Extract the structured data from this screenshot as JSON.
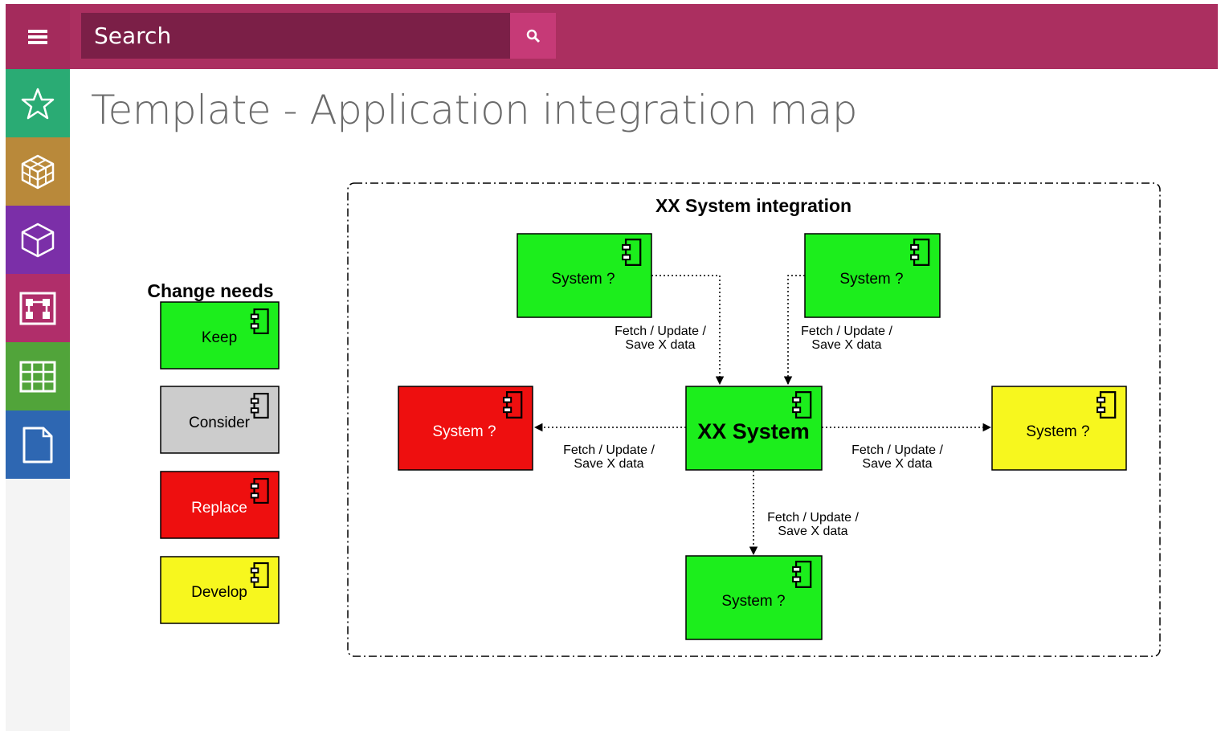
{
  "colors": {
    "topbar": "#ab2f60",
    "search_bg": "#7b1f47",
    "search_button": "#c63a77",
    "keep": "#1cee1c",
    "consider": "#cccccc",
    "replace": "#ee0f0f",
    "develop": "#f7f71e"
  },
  "header": {
    "menu_icon": "hamburger-menu-icon",
    "search_placeholder": "Search",
    "search_icon": "magnifier-icon"
  },
  "sidebar": {
    "items": [
      {
        "icon": "star-icon",
        "color": "#2aab74"
      },
      {
        "icon": "cubes-icon",
        "color": "#b9893a"
      },
      {
        "icon": "cube-icon",
        "color": "#7b2fa8"
      },
      {
        "icon": "integration-board-icon",
        "color": "#b02e6a"
      },
      {
        "icon": "table-grid-icon",
        "color": "#51a43a"
      },
      {
        "icon": "document-icon",
        "color": "#2e67b2"
      }
    ]
  },
  "page": {
    "title": "Template - Application integration map"
  },
  "legend": {
    "title": "Change needs",
    "items": [
      {
        "label": "Keep"
      },
      {
        "label": "Consider"
      },
      {
        "label": "Replace"
      },
      {
        "label": "Develop"
      }
    ]
  },
  "diagram": {
    "title": "XX System integration",
    "center_label": "XX System",
    "nodes": [
      {
        "label": "System ?"
      },
      {
        "label": "System ?"
      },
      {
        "label": "System ?"
      },
      {
        "label": "System ?"
      },
      {
        "label": "System ?"
      }
    ],
    "edge_label_line1": "Fetch / Update /",
    "edge_label_line2": "Save X data"
  }
}
